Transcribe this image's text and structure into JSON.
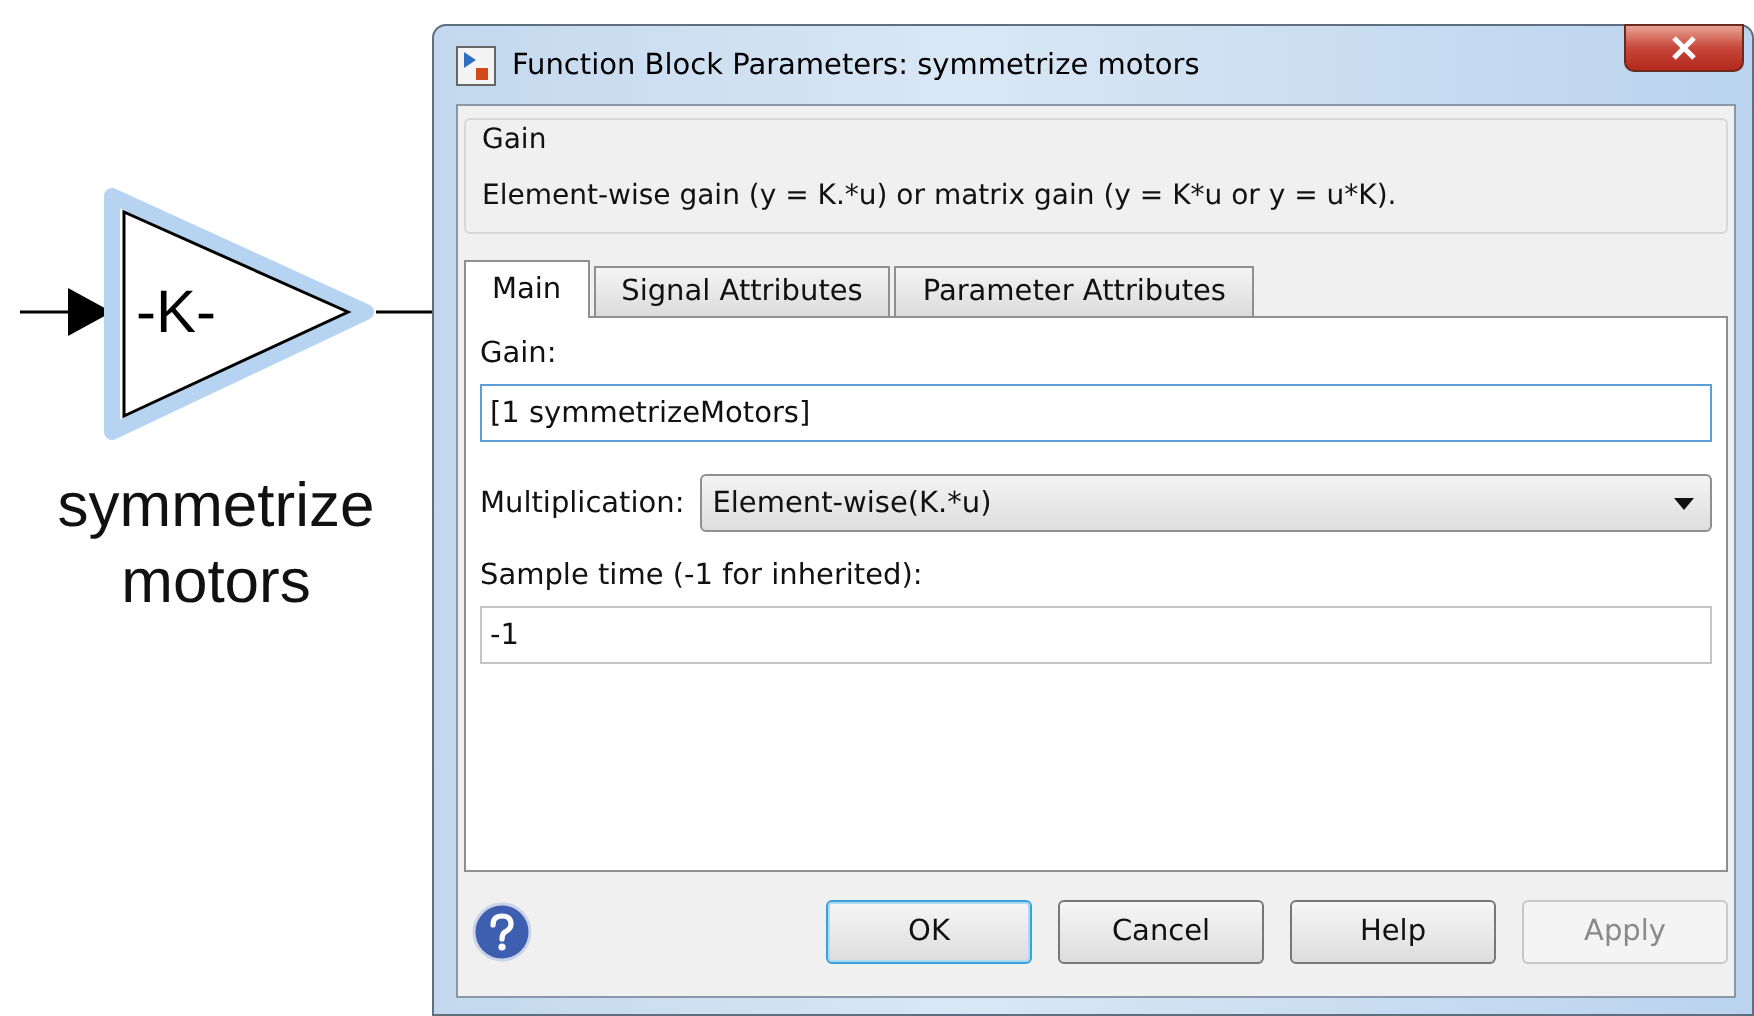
{
  "diagram": {
    "block_symbol": "-K-",
    "block_name": "symmetrize motors",
    "selected": true
  },
  "dialog": {
    "title": "Function Block Parameters: symmetrize motors",
    "group": {
      "title": "Gain",
      "description": "Element-wise gain (y = K.*u) or matrix gain (y = K*u or y = u*K)."
    },
    "tabs": [
      {
        "label": "Main",
        "selected": true
      },
      {
        "label": "Signal Attributes",
        "selected": false
      },
      {
        "label": "Parameter Attributes",
        "selected": false
      }
    ],
    "fields": [
      {
        "kind": "text",
        "label": "Gain:",
        "value": "[1 symmetrizeMotors]",
        "focused": true
      },
      {
        "kind": "select",
        "label": "Multiplication:",
        "value": "Element-wise(K.*u)"
      },
      {
        "kind": "text",
        "label": "Sample time (-1 for inherited):",
        "value": "-1",
        "focused": false
      }
    ],
    "buttons": [
      {
        "label": "OK",
        "default": true,
        "disabled": false
      },
      {
        "label": "Cancel",
        "default": false,
        "disabled": false
      },
      {
        "label": "Help",
        "default": false,
        "disabled": false
      },
      {
        "label": "Apply",
        "default": false,
        "disabled": true
      }
    ]
  }
}
